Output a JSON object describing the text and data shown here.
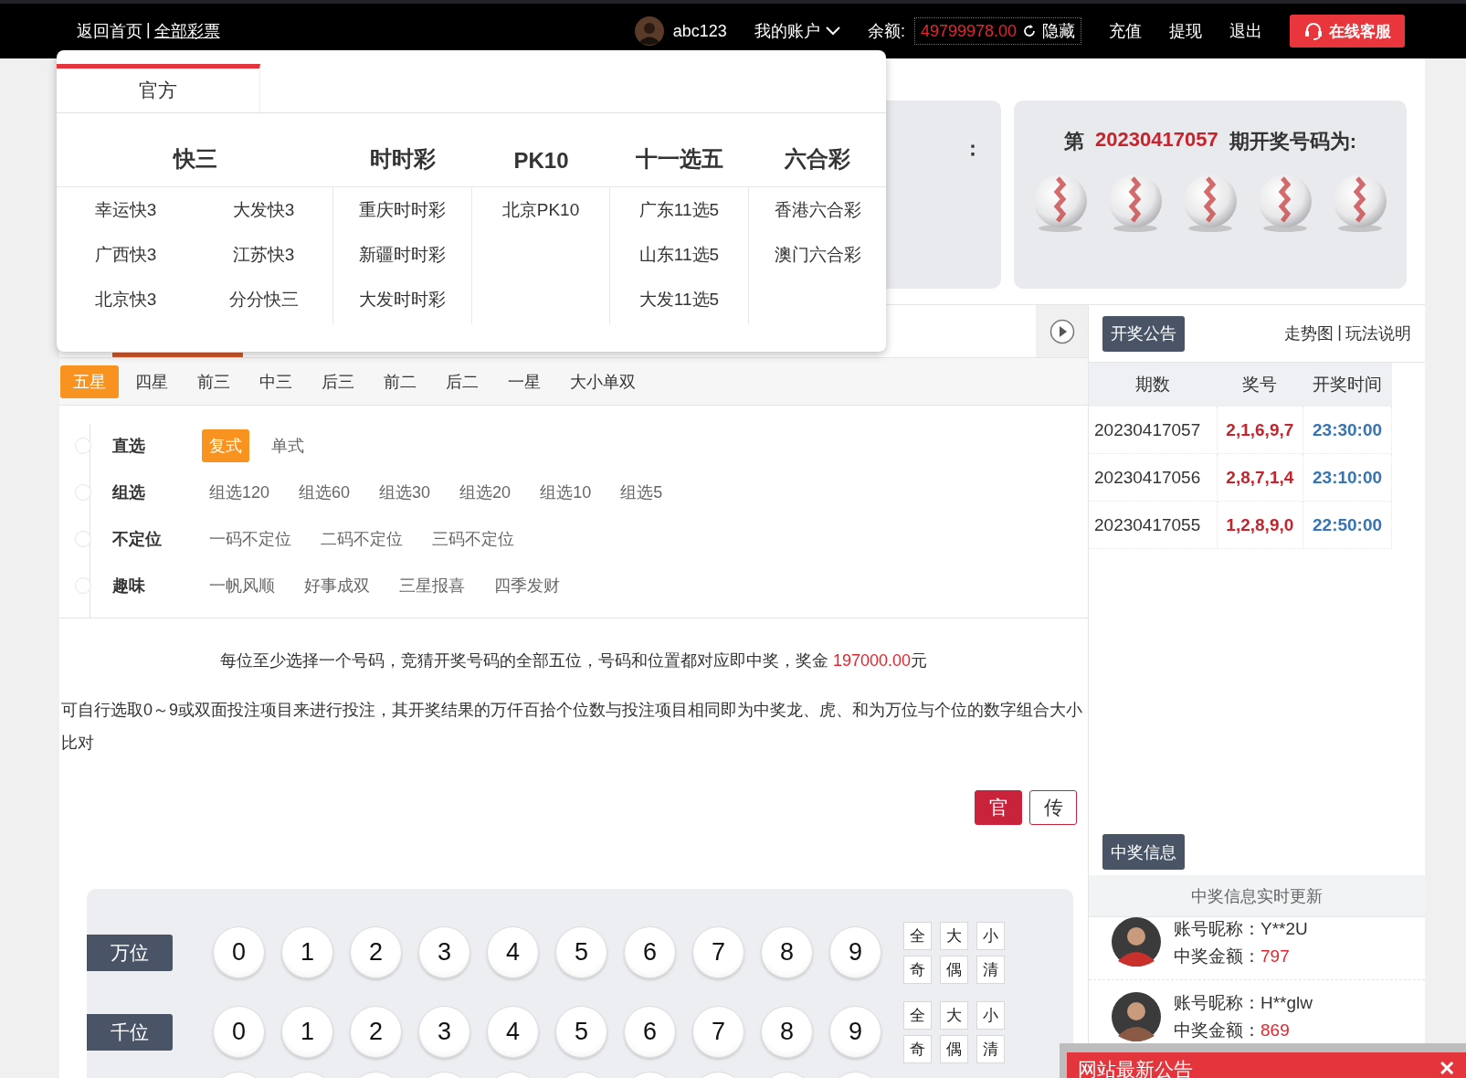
{
  "top_bar": {
    "home_link": "返回首页",
    "separator": "|",
    "all_link": "全部彩票",
    "user": "abc123",
    "account_menu": "我的账户",
    "balance_label": "余额:",
    "balance": "49799978.00",
    "hide": "隐藏",
    "actions": [
      "充值",
      "提现",
      "退出"
    ],
    "service": "在线客服"
  },
  "lottery_menu": {
    "tabs": [
      {
        "label": "官方",
        "selected": true
      }
    ],
    "groups": [
      {
        "title": "快三",
        "items": [
          "幸运快3",
          "大发快3",
          "广西快3",
          "江苏快3",
          "北京快3",
          "分分快三"
        ]
      },
      {
        "title": "时时彩",
        "items": [
          "重庆时时彩",
          "新疆时时彩",
          "大发时时彩"
        ]
      },
      {
        "title": "PK10",
        "items": [
          "北京PK10"
        ]
      },
      {
        "title": "十一选五",
        "items": [
          "广东11选5",
          "山东11选5",
          "大发11选5"
        ]
      },
      {
        "title": "六合彩",
        "items": [
          "香港六合彩",
          "澳门六合彩"
        ]
      }
    ]
  },
  "current_card": {
    "label_tail": "："
  },
  "draw_card": {
    "prefix": "第",
    "issue": "20230417057",
    "suffix": "期开奖号码为:"
  },
  "play_tabs": [
    {
      "label": "五星",
      "selected": true
    },
    {
      "label": "四星",
      "selected": false
    },
    {
      "label": "前三",
      "selected": false
    },
    {
      "label": "中三",
      "selected": false
    },
    {
      "label": "后三",
      "selected": false
    },
    {
      "label": "前二",
      "selected": false
    },
    {
      "label": "后二",
      "selected": false
    },
    {
      "label": "一星",
      "selected": false
    },
    {
      "label": "大小单双",
      "selected": false
    }
  ],
  "play_groups": [
    {
      "title": "直选",
      "options": [
        {
          "label": "复式",
          "selected": true
        },
        {
          "label": "单式",
          "selected": false
        }
      ]
    },
    {
      "title": "组选",
      "options": [
        {
          "label": "组选120",
          "selected": false
        },
        {
          "label": "组选60",
          "selected": false
        },
        {
          "label": "组选30",
          "selected": false
        },
        {
          "label": "组选20",
          "selected": false
        },
        {
          "label": "组选10",
          "selected": false
        },
        {
          "label": "组选5",
          "selected": false
        }
      ]
    },
    {
      "title": "不定位",
      "options": [
        {
          "label": "一码不定位",
          "selected": false
        },
        {
          "label": "二码不定位",
          "selected": false
        },
        {
          "label": "三码不定位",
          "selected": false
        }
      ]
    },
    {
      "title": "趣味",
      "options": [
        {
          "label": "一帆风顺",
          "selected": false
        },
        {
          "label": "好事成双",
          "selected": false
        },
        {
          "label": "三星报喜",
          "selected": false
        },
        {
          "label": "四季发财",
          "selected": false
        }
      ]
    }
  ],
  "rule": {
    "text": "每位至少选择一个号码，竞猜开奖号码的全部五位，号码和位置都对应即中奖，奖金 ",
    "prize": "197000.00",
    "unit": "元"
  },
  "note": "可自行选取0～9或双面投注项目来进行投注，其开奖结果的万仟百拾个位数与投注项目相同即为中奖龙、虎、和为万位与个位的数字组合大小比对",
  "mode_buttons": [
    {
      "label": "官",
      "selected": true
    },
    {
      "label": "传",
      "selected": false
    }
  ],
  "positions": [
    {
      "label": "万位",
      "numbers": [
        "0",
        "1",
        "2",
        "3",
        "4",
        "5",
        "6",
        "7",
        "8",
        "9"
      ],
      "quick": [
        "全",
        "大",
        "小",
        "奇",
        "偶",
        "清"
      ]
    },
    {
      "label": "千位",
      "numbers": [
        "0",
        "1",
        "2",
        "3",
        "4",
        "5",
        "6",
        "7",
        "8",
        "9"
      ],
      "quick": [
        "全",
        "大",
        "小",
        "奇",
        "偶",
        "清"
      ]
    }
  ],
  "results": {
    "title": "开奖公告",
    "trend_link": "走势图",
    "separator": "|",
    "rules_link": "玩法说明",
    "columns": [
      "期数",
      "奖号",
      "开奖时间"
    ],
    "rows": [
      {
        "issue": "20230417057",
        "numbers": "2,1,6,9,7",
        "time": "23:30:00"
      },
      {
        "issue": "20230417056",
        "numbers": "2,8,7,1,4",
        "time": "23:10:00"
      },
      {
        "issue": "20230417055",
        "numbers": "1,2,8,9,0",
        "time": "22:50:00"
      }
    ]
  },
  "winners": {
    "title": "中奖信息",
    "subtitle": "中奖信息实时更新",
    "items": [
      {
        "name_label": "账号昵称：",
        "name": "Y**2U",
        "amount_label": "中奖金额：",
        "amount": "797"
      },
      {
        "name_label": "账号昵称：",
        "name": "H**glw",
        "amount_label": "中奖金额：",
        "amount": "869"
      }
    ]
  },
  "notice": {
    "title": "网站最新公告",
    "close": "✕"
  }
}
